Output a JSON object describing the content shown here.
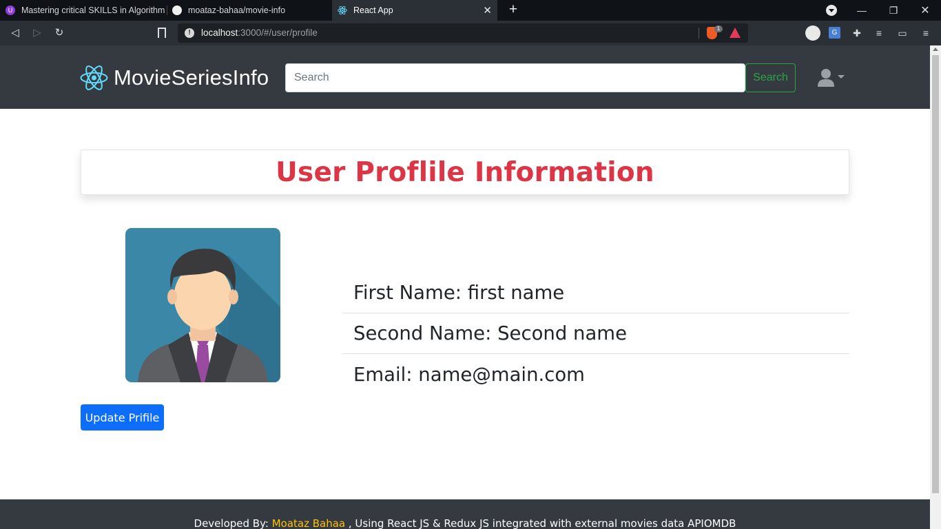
{
  "browser": {
    "tabs": [
      {
        "title": "Mastering critical SKILLS in Algorithms",
        "active": false,
        "icon": "udemy-icon"
      },
      {
        "title": "moataz-bahaa/movie-info",
        "active": false,
        "icon": "github-icon"
      },
      {
        "title": "React App",
        "active": true,
        "icon": "react-icon"
      }
    ],
    "url_host": "localhost",
    "url_path": ":3000/#/user/profile",
    "brave_badge": "1"
  },
  "navbar": {
    "brand": "MovieSeriesInfo",
    "search_placeholder": "Search",
    "search_button": "Search"
  },
  "profile": {
    "title": "User Proflile Information",
    "first_name": "First Name: first name",
    "second_name": "Second Name: Second name",
    "email": "Email: name@main.com",
    "update_button": "Update Prifile"
  },
  "footer": {
    "prefix": "Developed By: ",
    "author": "Moataz Bahaa",
    "suffix": " , Using React JS & Redux JS integrated with external movies data APIOMDB"
  },
  "colors": {
    "navbar": "#343a40",
    "title": "#dc3545",
    "primary_button": "#0d6efd",
    "search_outline": "#28a745",
    "footer_author": "#ffc107"
  }
}
